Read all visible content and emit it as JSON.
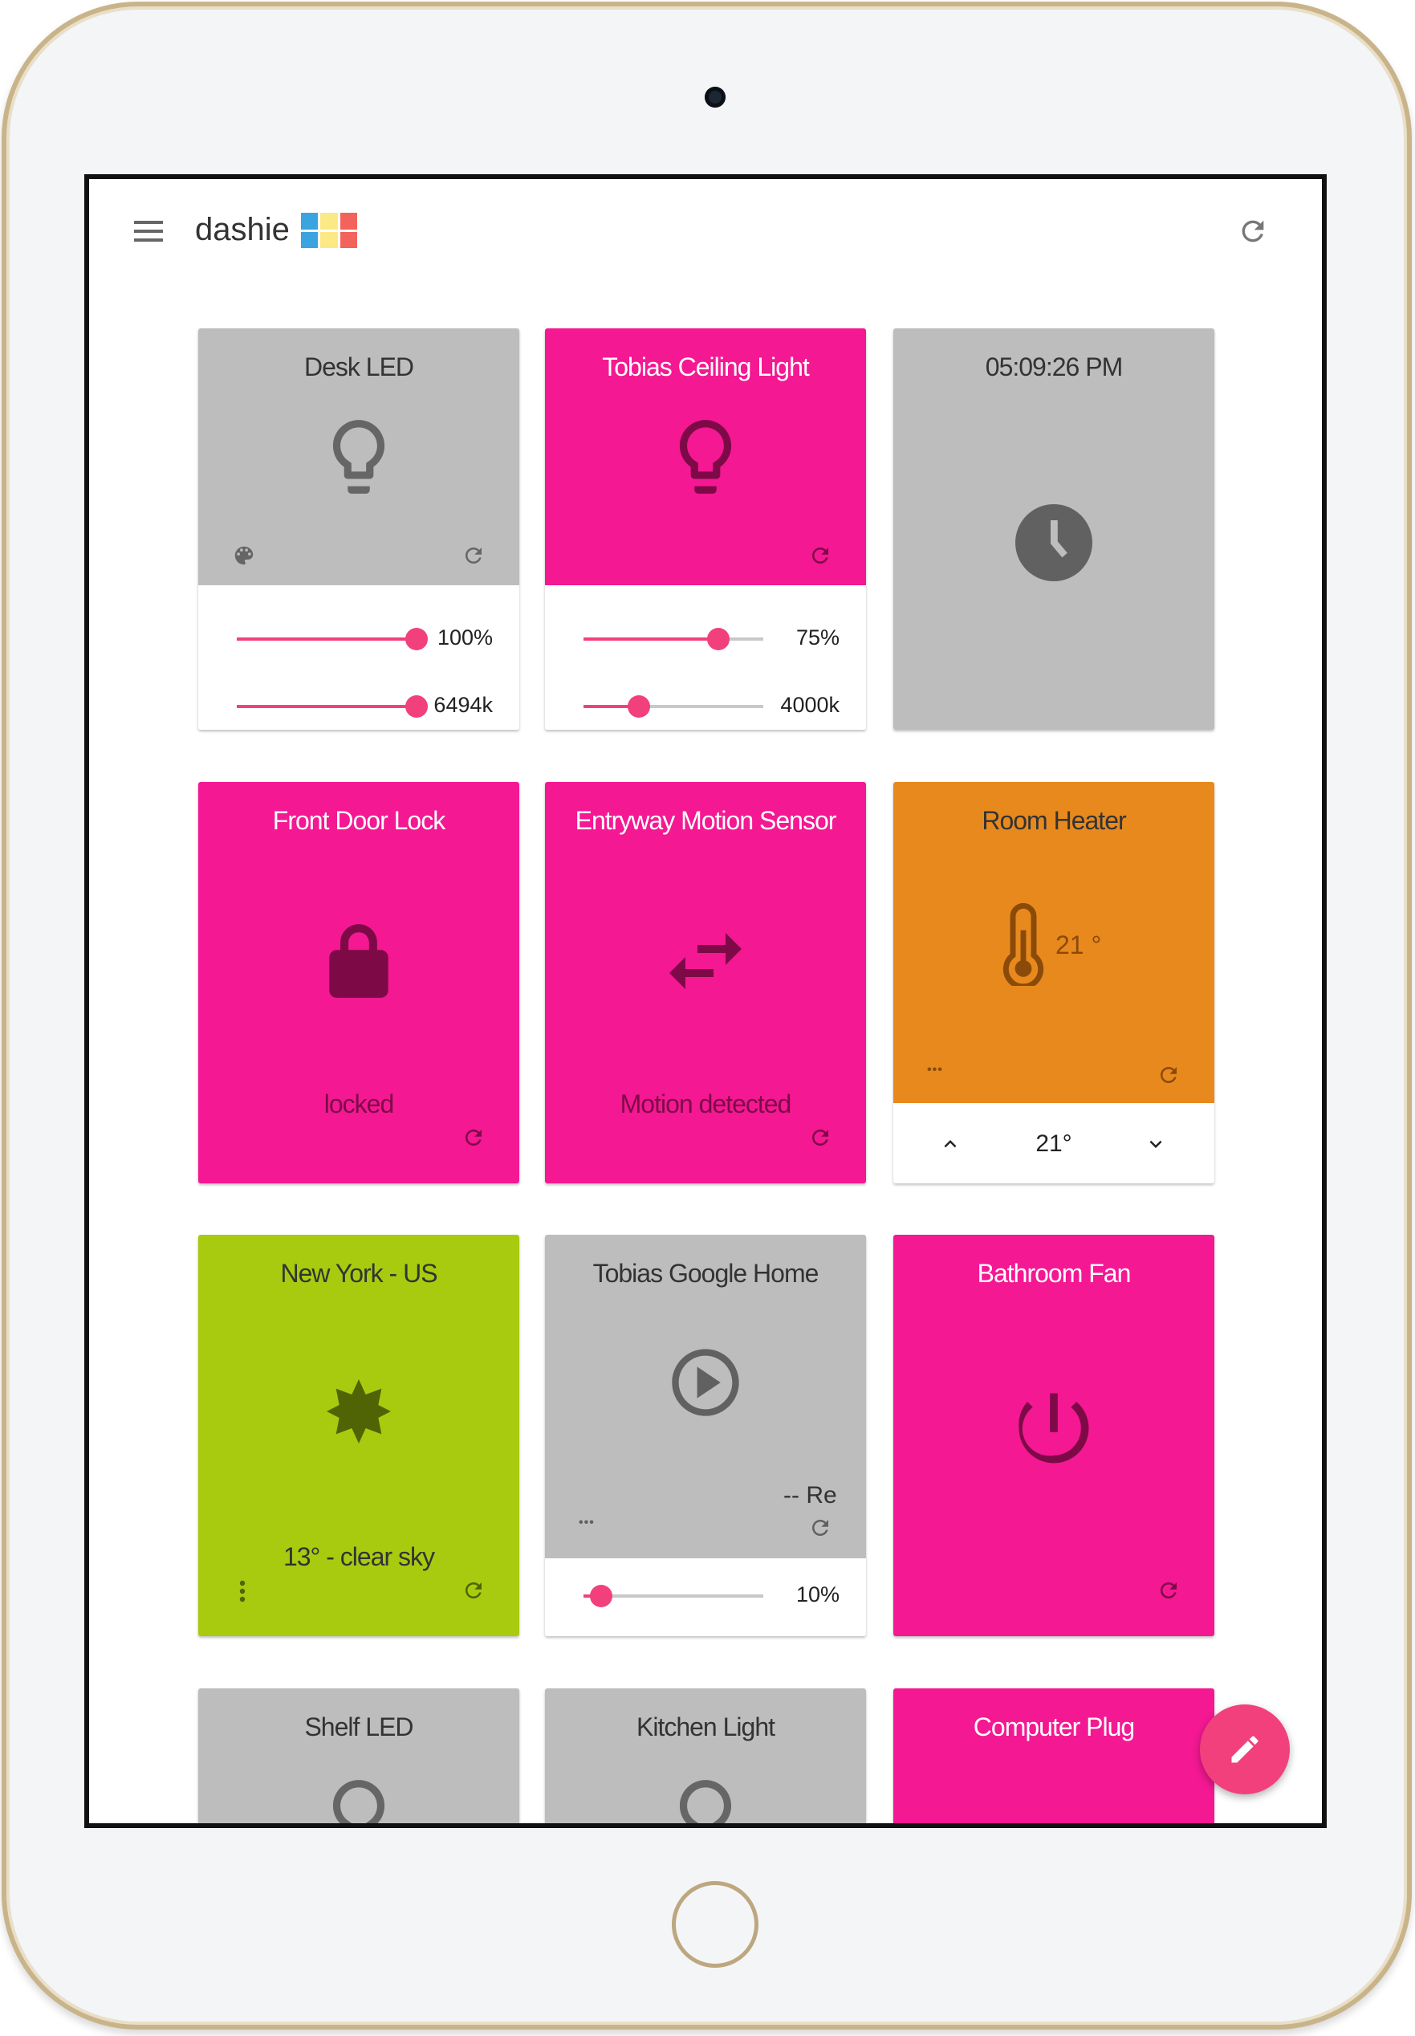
{
  "app": {
    "name": "dashie",
    "logo_colors": [
      "#3aa4e0",
      "#fbe985",
      "#f2635b"
    ]
  },
  "colors": {
    "gray": "#bdbdbd",
    "pink": "#f41893",
    "orange": "#e8891d",
    "green": "#a8cb10",
    "accent": "#f2407c"
  },
  "cards": [
    {
      "title": "Desk LED",
      "icon": "lightbulb-icon",
      "brightness": "100%",
      "brightness_value": 100,
      "temperature": "6494k",
      "temperature_fraction": 1.0
    },
    {
      "title": "Tobias Ceiling Light",
      "icon": "lightbulb-icon",
      "brightness": "75%",
      "brightness_value": 75,
      "temperature": "4000k",
      "temperature_fraction": 0.31
    },
    {
      "title": "05:09:26 PM",
      "icon": "clock-icon"
    },
    {
      "title": "Front Door Lock",
      "icon": "lock-icon",
      "status": "locked"
    },
    {
      "title": "Entryway Motion Sensor",
      "icon": "swap-arrows-icon",
      "status": "Motion detected"
    },
    {
      "title": "Room Heater",
      "icon": "thermometer-icon",
      "current": "21 °",
      "more": "•••",
      "target": "21°"
    },
    {
      "title": "New York - US",
      "icon": "sun-icon",
      "status": "13° - clear sky"
    },
    {
      "title": "Tobias Google Home",
      "icon": "play-icon",
      "track": "-- Re",
      "more": "•••",
      "volume": "10%",
      "volume_value": 10
    },
    {
      "title": "Bathroom Fan",
      "icon": "power-icon"
    },
    {
      "title": "Shelf LED",
      "icon": "lightbulb-icon"
    },
    {
      "title": "Kitchen Light",
      "icon": "lightbulb-icon"
    },
    {
      "title": "Computer Plug",
      "icon": "power-icon"
    }
  ]
}
